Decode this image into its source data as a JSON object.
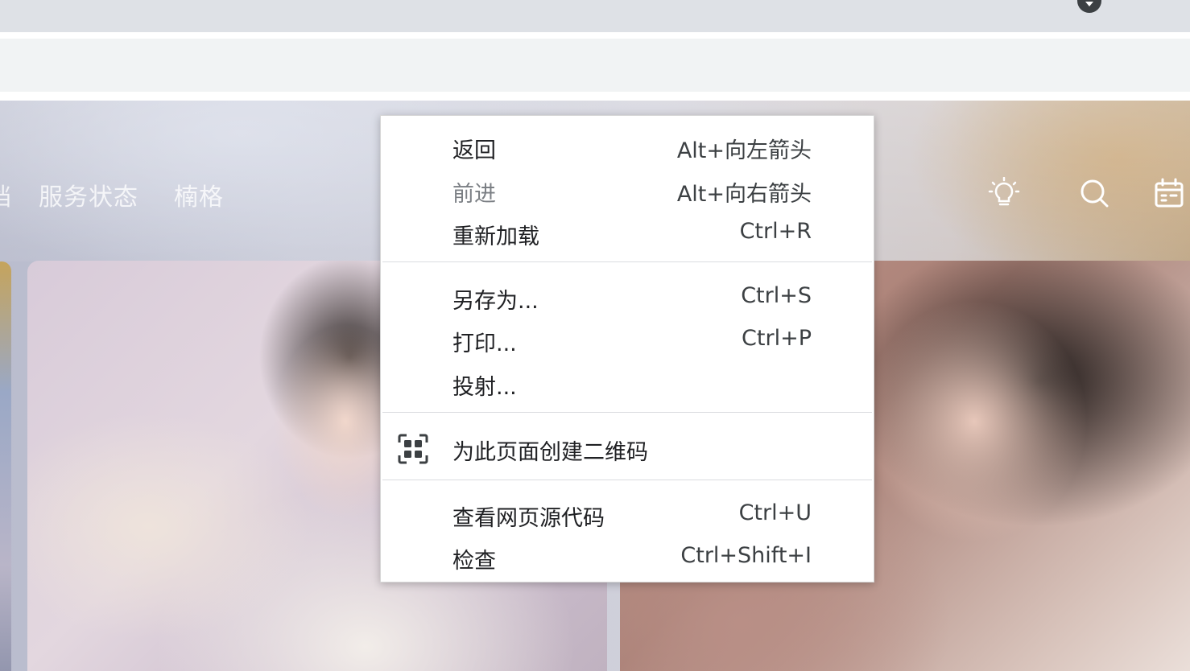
{
  "header_nav": {
    "partial_item": "档",
    "status": "服务状态",
    "nange": "楠格"
  },
  "header_icons": [
    "lightbulb-icon",
    "search-icon",
    "calendar-icon"
  ],
  "context_menu": {
    "back": {
      "label": "返回",
      "shortcut": "Alt+向左箭头"
    },
    "forward": {
      "label": "前进",
      "shortcut": "Alt+向右箭头"
    },
    "reload": {
      "label": "重新加载",
      "shortcut": "Ctrl+R"
    },
    "save_as": {
      "label": "另存为...",
      "shortcut": "Ctrl+S"
    },
    "print": {
      "label": "打印...",
      "shortcut": "Ctrl+P"
    },
    "cast": {
      "label": "投射..."
    },
    "qr_code": {
      "label": "为此页面创建二维码",
      "icon": "qr-code-icon"
    },
    "view_source": {
      "label": "查看网页源代码",
      "shortcut": "Ctrl+U"
    },
    "inspect": {
      "label": "检查",
      "shortcut": "Ctrl+Shift+I"
    }
  },
  "colors": {
    "menu_bg": "#ffffff",
    "menu_text": "#202124",
    "disabled_text": "#7b7f84",
    "separator": "#dadce0",
    "toolbar_bg": "#f1f3f4",
    "tabstrip_bg": "#dee1e6"
  }
}
